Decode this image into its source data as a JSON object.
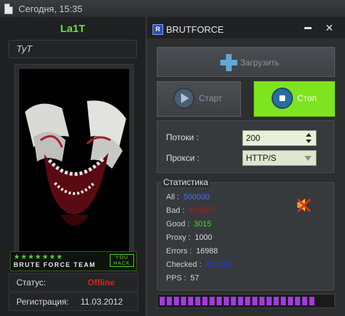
{
  "post": {
    "date": "Сегодня, 15:35"
  },
  "user": {
    "name": "La1T",
    "title": "ТуТ",
    "banner": {
      "stars": "★★★★★★★",
      "team": "BRUTE FORCE TEAM",
      "badge_line1": "YOU",
      "badge_line2": "HACK"
    },
    "status_label": "Статус:",
    "status_value": "Offline",
    "reg_label": "Регистрация:",
    "reg_value": "11.03.2012"
  },
  "app": {
    "icon_letter": "R",
    "title": "BRUTFORCE",
    "minimize": "▬",
    "close": "✕",
    "load_label": "Загрузить",
    "start_label": "Старт",
    "stop_label": "Стоп",
    "threads_label": "Потоки :",
    "threads_value": "200",
    "proxy_label": "Прокси  :",
    "proxy_value": "HTTP/S",
    "stats_title": "Статистика",
    "stats": [
      {
        "key": "All :",
        "value": "500000",
        "color": "#3a78e6"
      },
      {
        "key": "Bad :",
        "value": "415257",
        "color": "#b01a1a"
      },
      {
        "key": "Good :",
        "value": "3015",
        "color": "#37e62c"
      },
      {
        "key": "Proxy :",
        "value": "1000",
        "color": "#dcdcdc"
      },
      {
        "key": "Errors :",
        "value": "16988",
        "color": "#dcdcdc"
      },
      {
        "key": "Checked :",
        "value": "435260",
        "color": "#2a38d6"
      },
      {
        "key": "PPS :",
        "value": "57",
        "color": "#dcdcdc"
      }
    ],
    "progress_percent": 87,
    "colors": {
      "accent_green": "#7ee41f",
      "progress": "#a43ae0"
    }
  }
}
